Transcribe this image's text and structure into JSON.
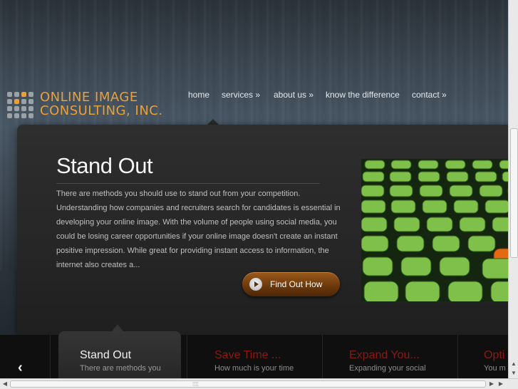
{
  "logo": {
    "line1": "ONLINE IMAGE",
    "line2": "CONSULTING, INC.",
    "accent_color": "#e8a03a",
    "icon": "dot-grid-logo-icon"
  },
  "nav": {
    "items": [
      {
        "label": "home"
      },
      {
        "label": "services »"
      },
      {
        "label": "about us »"
      },
      {
        "label": "know the difference"
      },
      {
        "label": "contact »"
      }
    ]
  },
  "feature": {
    "title": "Stand Out",
    "body": "There are methods you should use to stand out from your competition. Understanding how companies and recruiters search for candidates is essential in developing your online image.  With the volume of people using social media, you could be losing career opportunities if your online image doesn't create an instant positive impression.  While great for providing instant access to information, the internet also creates a...",
    "button_label": "Find Out How",
    "button_icon": "play-icon",
    "image": "green stadium seats with one orange seat"
  },
  "slider": {
    "prev_icon": "chevron-left-icon",
    "tabs": [
      {
        "title": "Stand Out",
        "text": "There are methods you",
        "active": true
      },
      {
        "title": "Save Time ...",
        "text": "How much is your time",
        "active": false
      },
      {
        "title": "Expand You...",
        "text": "Expanding your social",
        "active": false
      },
      {
        "title": "Opti",
        "text": "You m",
        "active": false
      }
    ],
    "active_color": "#f0f0f0",
    "inactive_color": "#8b1a14"
  }
}
